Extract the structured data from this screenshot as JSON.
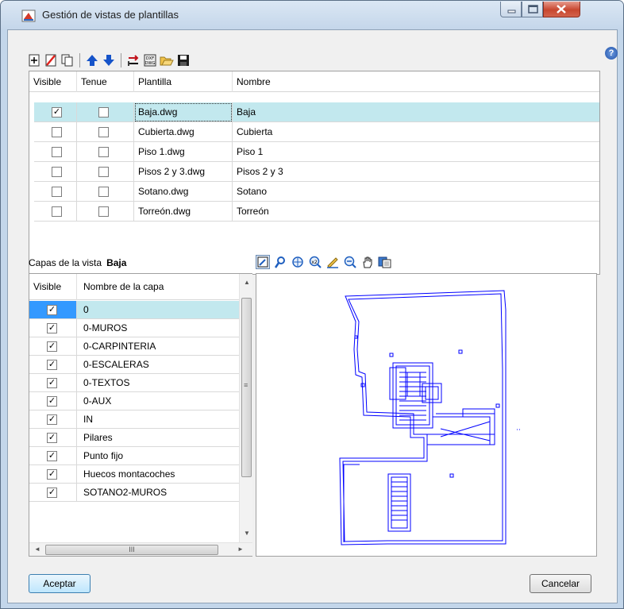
{
  "window": {
    "title": "Gestión de vistas de plantillas"
  },
  "toolbar": {
    "icons": [
      "add-icon",
      "delete-icon",
      "copy-icon",
      "move-up-icon",
      "move-down-icon",
      "swap-icon",
      "dxf-dwg-icon",
      "open-folder-icon",
      "save-icon"
    ]
  },
  "templates": {
    "headers": [
      "Visible",
      "Tenue",
      "Plantilla",
      "Nombre"
    ],
    "rows": [
      {
        "visible": true,
        "tenue": false,
        "plantilla": "Baja.dwg",
        "nombre": "Baja"
      },
      {
        "visible": false,
        "tenue": false,
        "plantilla": "Cubierta.dwg",
        "nombre": "Cubierta"
      },
      {
        "visible": false,
        "tenue": false,
        "plantilla": "Piso 1.dwg",
        "nombre": "Piso 1"
      },
      {
        "visible": false,
        "tenue": false,
        "plantilla": "Pisos 2 y 3.dwg",
        "nombre": "Pisos 2 y 3"
      },
      {
        "visible": false,
        "tenue": false,
        "plantilla": "Sotano.dwg",
        "nombre": "Sotano"
      },
      {
        "visible": false,
        "tenue": false,
        "plantilla": "Torreón.dwg",
        "nombre": "Torreón"
      }
    ]
  },
  "layers": {
    "caption": "Capas de la vista",
    "view_name": "Baja",
    "headers": [
      "Visible",
      "Nombre de la capa"
    ],
    "rows": [
      {
        "visible": true,
        "name": "0"
      },
      {
        "visible": true,
        "name": "0-MUROS"
      },
      {
        "visible": true,
        "name": "0-CARPINTERIA"
      },
      {
        "visible": true,
        "name": "0-ESCALERAS"
      },
      {
        "visible": true,
        "name": "0-TEXTOS"
      },
      {
        "visible": true,
        "name": "0-AUX"
      },
      {
        "visible": true,
        "name": "IN"
      },
      {
        "visible": true,
        "name": "Pilares"
      },
      {
        "visible": true,
        "name": "Punto fijo"
      },
      {
        "visible": true,
        "name": "Huecos montacoches"
      },
      {
        "visible": true,
        "name": "SOTANO2-MUROS"
      }
    ]
  },
  "preview_toolbar": {
    "icons": [
      "zoom-window-icon",
      "pan-realtime-icon",
      "zoom-extents-icon",
      "zoom-x2-icon",
      "measure-icon",
      "zoom-out-icon",
      "hand-icon",
      "layers-icon"
    ]
  },
  "buttons": {
    "ok": "Aceptar",
    "cancel": "Cancelar"
  },
  "colors": {
    "selection": "#c2e8ee",
    "accent": "#3399ff",
    "drawing": "#0000ff"
  }
}
